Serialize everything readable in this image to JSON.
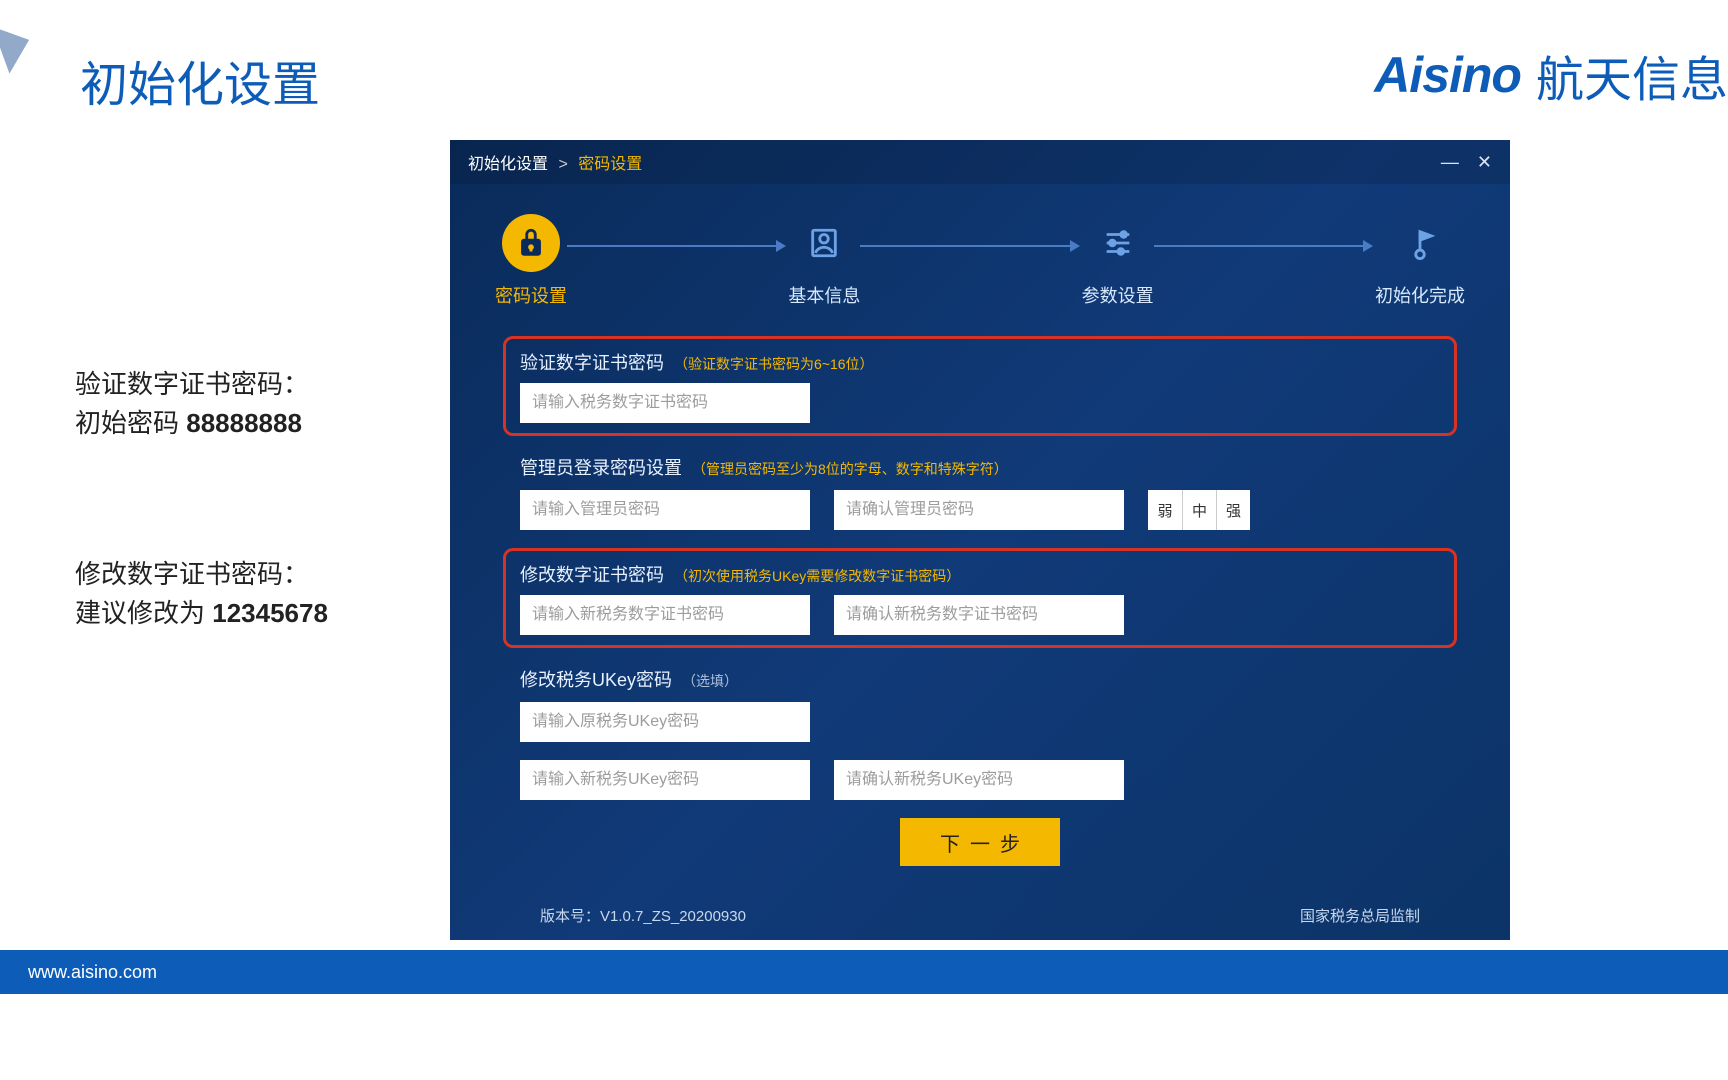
{
  "page_title": "初始化设置",
  "brand": {
    "logo": "Aisino",
    "name": "航天信息"
  },
  "side_notes": {
    "note1_line1": "验证数字证书密码：",
    "note1_line2a": "初始密码 ",
    "note1_line2b": "88888888",
    "note2_line1": "修改数字证书密码：",
    "note2_line2a": "建议修改为 ",
    "note2_line2b": "12345678"
  },
  "window": {
    "breadcrumb_root": "初始化设置",
    "breadcrumb_current": "密码设置",
    "steps": {
      "s1": "密码设置",
      "s2": "基本信息",
      "s3": "参数设置",
      "s4": "初始化完成"
    },
    "section1": {
      "label": "验证数字证书密码",
      "hint": "（验证数字证书密码为6~16位）",
      "placeholder": "请输入税务数字证书密码"
    },
    "section2": {
      "label": "管理员登录密码设置",
      "hint": "（管理员密码至少为8位的字母、数字和特殊字符）",
      "placeholder1": "请输入管理员密码",
      "placeholder2": "请确认管理员密码",
      "strength_weak": "弱",
      "strength_mid": "中",
      "strength_strong": "强"
    },
    "section3": {
      "label": "修改数字证书密码",
      "hint": "（初次使用税务UKey需要修改数字证书密码）",
      "placeholder1": "请输入新税务数字证书密码",
      "placeholder2": "请确认新税务数字证书密码"
    },
    "section4": {
      "label": "修改税务UKey密码",
      "hint": "（选填）",
      "placeholder_old": "请输入原税务UKey密码",
      "placeholder_new": "请输入新税务UKey密码",
      "placeholder_confirm": "请确认新税务UKey密码"
    },
    "next_button": "下一步",
    "footer_version": "版本号：V1.0.7_ZS_20200930",
    "footer_authority": "国家税务总局监制"
  },
  "footer_url": "www.aisino.com"
}
